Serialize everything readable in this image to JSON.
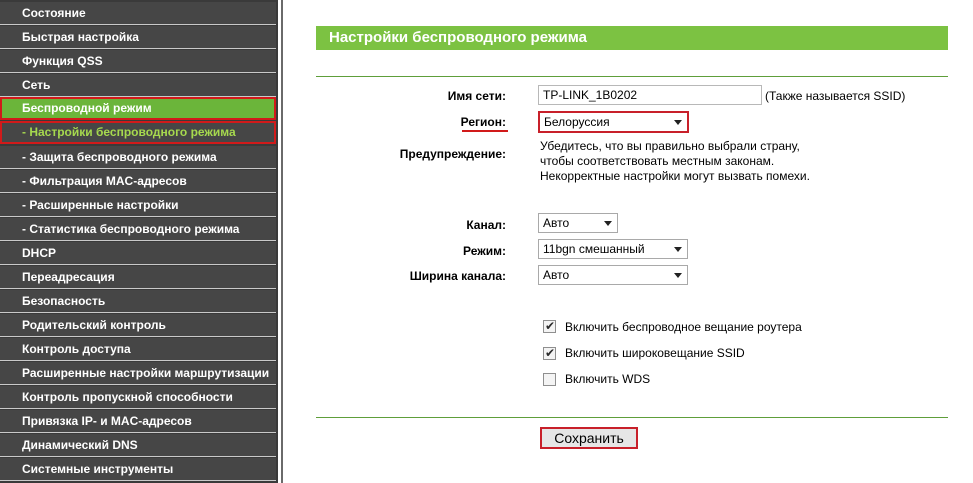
{
  "sidebar": {
    "items": [
      {
        "label": "Состояние"
      },
      {
        "label": "Быстрая настройка"
      },
      {
        "label": "Функция QSS"
      },
      {
        "label": "Сеть"
      },
      {
        "label": "Беспроводной режим"
      },
      {
        "label": "- Настройки беспроводного режима"
      },
      {
        "label": "- Защита беспроводного режима"
      },
      {
        "label": "- Фильтрация MAC-адресов"
      },
      {
        "label": "- Расширенные настройки"
      },
      {
        "label": "- Статистика беспроводного режима"
      },
      {
        "label": "DHCP"
      },
      {
        "label": "Переадресация"
      },
      {
        "label": "Безопасность"
      },
      {
        "label": "Родительский контроль"
      },
      {
        "label": "Контроль доступа"
      },
      {
        "label": "Расширенные настройки маршрутизации"
      },
      {
        "label": "Контроль пропускной способности"
      },
      {
        "label": "Привязка IP- и MAC-адресов"
      },
      {
        "label": "Динамический DNS"
      },
      {
        "label": "Системные инструменты"
      }
    ]
  },
  "page": {
    "title": "Настройки беспроводного режима"
  },
  "form": {
    "ssid_label": "Имя сети:",
    "ssid_value": "TP-LINK_1B0202",
    "ssid_hint": "(Также называется SSID)",
    "region_label": "Регион:",
    "region_value": "Белоруссия",
    "warning_label": "Предупреждение:",
    "warning_line1": "Убедитесь, что вы правильно выбрали страну,",
    "warning_line2": "чтобы соответствовать местным законам.",
    "warning_line3": "Некорректные настройки могут вызвать помехи.",
    "channel_label": "Канал:",
    "channel_value": "Авто",
    "mode_label": "Режим:",
    "mode_value": "11bgn смешанный",
    "width_label": "Ширина канала:",
    "width_value": "Авто",
    "cb_router_label": "Включить беспроводное вещание роутера",
    "cb_router_checked": true,
    "cb_ssid_label": "Включить широковещание SSID",
    "cb_ssid_checked": true,
    "cb_wds_label": "Включить WDS",
    "cb_wds_checked": false,
    "save_label": "Сохранить"
  },
  "colors": {
    "accent_green": "#7cc242",
    "highlight_red": "#c8202a",
    "sidebar_bg": "#464646"
  }
}
